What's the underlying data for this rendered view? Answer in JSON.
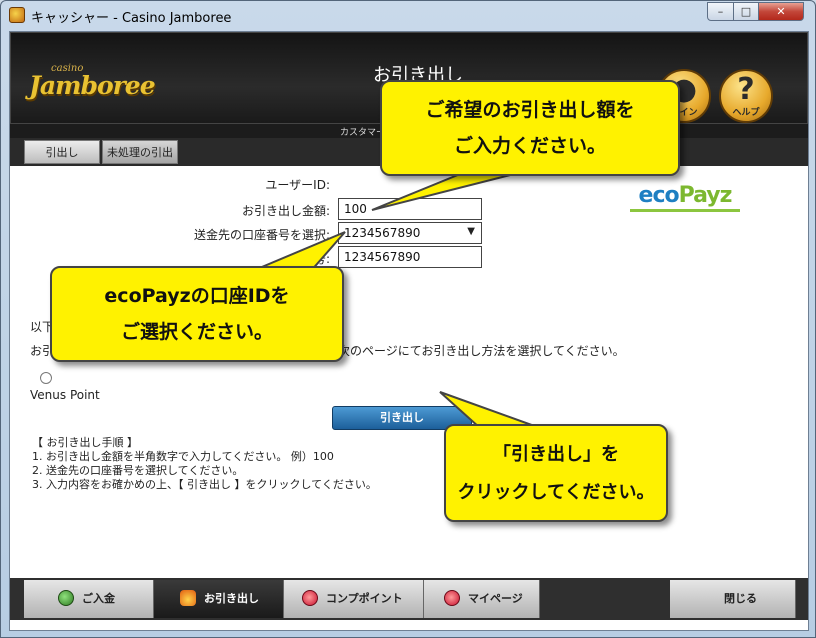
{
  "window": {
    "title": "キャッシャー - Casino Jamboree",
    "controls": {
      "minimize": "–",
      "maximize": "□",
      "close": "✕"
    }
  },
  "header": {
    "logo_small": "casino",
    "logo_main": "Jamboree",
    "page_title": "お引き出し",
    "coin_button_label": "コイン",
    "help_button_glyph": "?",
    "help_button_label": "ヘルプ",
    "support_text": "カスタマー"
  },
  "tabs": [
    {
      "label": "引出し"
    },
    {
      "label": "未処理の引出し"
    }
  ],
  "form": {
    "user_id_label": "ユーザーID:",
    "amount_label": "お引き出し金額:",
    "amount_value": "100",
    "account_select_label": "送金先の口座番号を選択:",
    "account_select_value": "1234567890",
    "account_number_label": "号:",
    "account_number_value": "1234567890",
    "brand": {
      "eco": "eco",
      "payz": "Payz"
    }
  },
  "info": {
    "line1": "以下",
    "line2_left": "お引",
    "line2_right": "次のページにてお引き出し方法を選択してください。",
    "radio_label": "Venus Point"
  },
  "withdraw_button": "引き出し",
  "steps": {
    "heading": "【 お引き出し手順 】",
    "items": [
      "1. お引き出し金額を半角数字で入力してください。 例）100",
      "2. 送金先の口座番号を選択してください。",
      "3. 入力内容をお確かめの上、【 引き出し 】をクリックしてください。"
    ]
  },
  "footer": {
    "deposit": "ご入金",
    "withdraw": "お引き出し",
    "comp_points": "コンプポイント",
    "my_page": "マイページ",
    "close": "閉じる"
  },
  "callouts": {
    "amount": [
      "ご希望のお引き出し額を",
      "ご入力ください。"
    ],
    "account": [
      "ecoPayzの口座IDを",
      "ご選択ください。"
    ],
    "click": [
      "「引き出し」を",
      "クリックしてください。"
    ]
  },
  "colors": {
    "callout": "#fff200",
    "header_bg": "#1a1a1a",
    "withdraw_button": "#1c5f9a",
    "eco_blue": "#1e7fc2",
    "eco_green": "#7cb82f"
  }
}
